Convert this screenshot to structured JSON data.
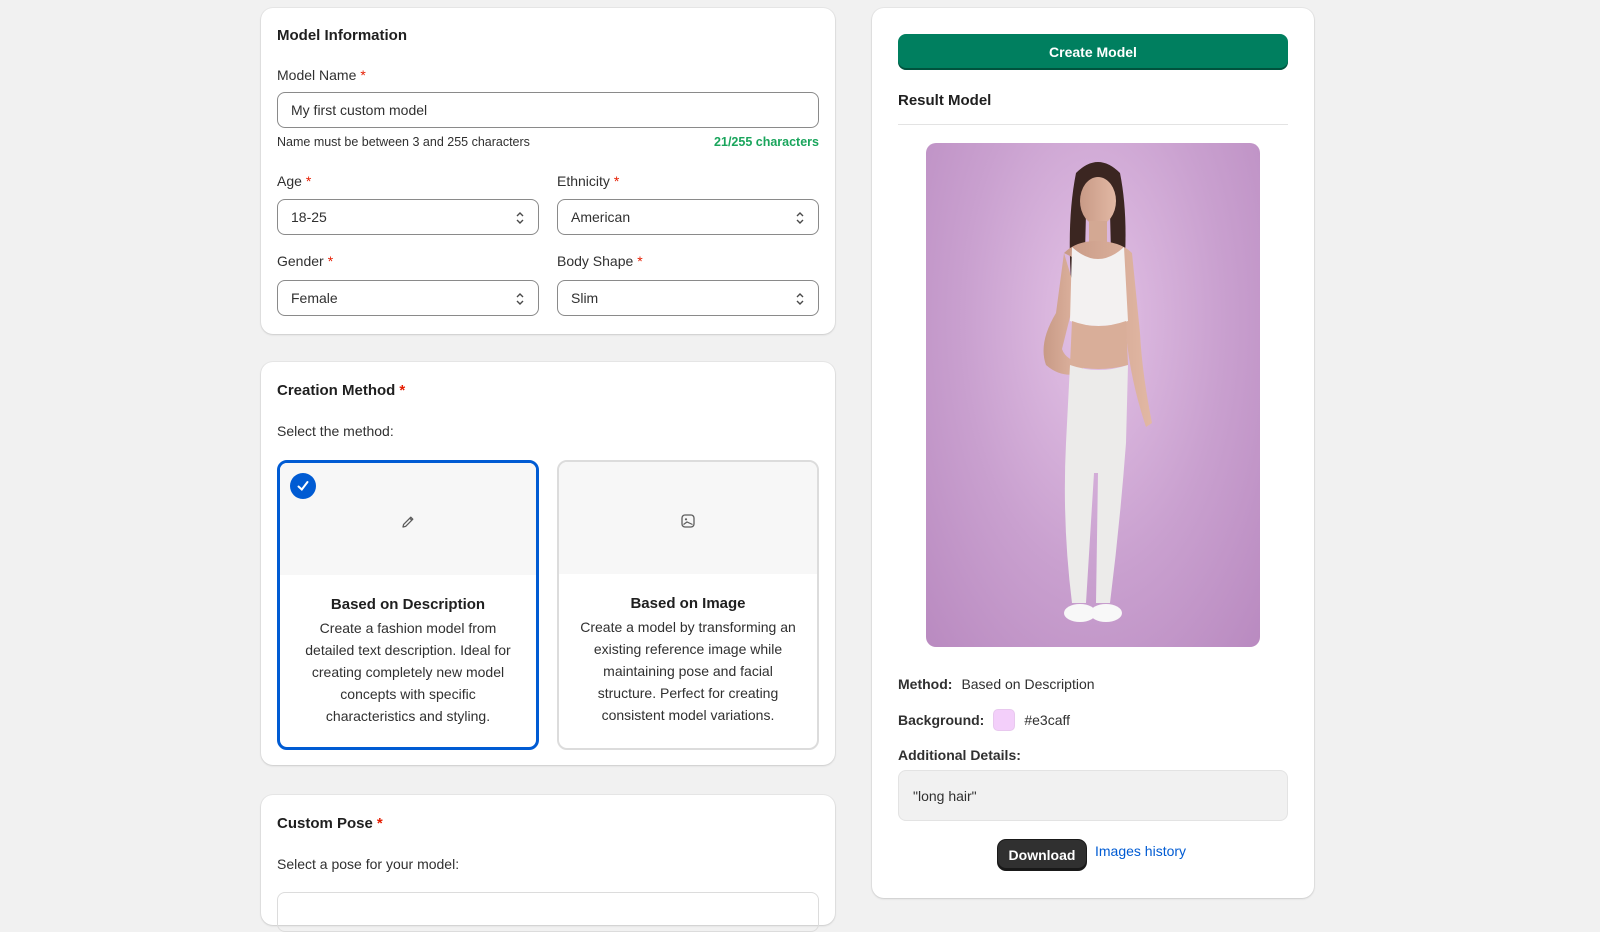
{
  "model_info": {
    "title": "Model Information",
    "name_label": "Model Name",
    "required_mark": "*",
    "name_value": "My first custom model",
    "name_help": "Name must be between 3 and 255 characters",
    "name_counter": "21/255 characters",
    "age_label": "Age",
    "age_value": "18-25",
    "ethnicity_label": "Ethnicity",
    "ethnicity_value": "American",
    "gender_label": "Gender",
    "gender_value": "Female",
    "body_label": "Body Shape",
    "body_value": "Slim"
  },
  "creation": {
    "title": "Creation Method",
    "required_mark": "*",
    "prompt": "Select the method:",
    "options": [
      {
        "title": "Based on Description",
        "description": "Create a fashion model from detailed text description. Ideal for creating completely new model concepts with specific characteristics and styling.",
        "icon": "pencil-icon",
        "selected": true
      },
      {
        "title": "Based on Image",
        "description": "Create a model by transforming an existing reference image while maintaining pose and facial structure. Perfect for creating consistent model variations.",
        "icon": "image-icon",
        "selected": false
      }
    ]
  },
  "pose": {
    "title": "Custom Pose",
    "required_mark": "*",
    "prompt": "Select a pose for your model:"
  },
  "result": {
    "create_label": "Create Model",
    "title": "Result Model",
    "method_label": "Method:",
    "method_value": "Based on Description",
    "background_label": "Background:",
    "background_value": "#e3caff",
    "details_label": "Additional Details:",
    "details_value": "\"long hair\"",
    "download_label": "Download",
    "history_label": "Images history"
  },
  "colors": {
    "primary_green": "#007f5f",
    "selected_blue": "#005bd3",
    "counter_green": "#1aa55c",
    "required_red": "#e51c00"
  }
}
